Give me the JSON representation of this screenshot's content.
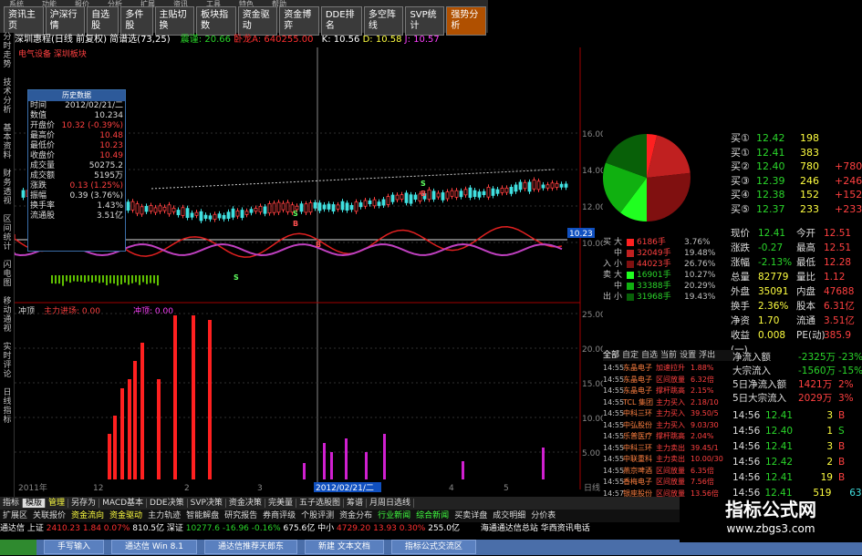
{
  "menu": [
    "系统",
    "功能",
    "报价",
    "分析",
    "扩展",
    "资讯",
    "工具",
    "特色",
    "帮助"
  ],
  "navtabs": [
    {
      "label": "资讯主页"
    },
    {
      "label": "沪深行情"
    },
    {
      "label": "自选股"
    },
    {
      "label": "多件股"
    },
    {
      "label": "主贴切换"
    },
    {
      "label": "板块指数"
    },
    {
      "label": "资金驱动"
    },
    {
      "label": "资金博弈"
    },
    {
      "label": "DDE排名"
    },
    {
      "label": "多空阵线"
    },
    {
      "label": "SVP统计"
    },
    {
      "label": "强势分析",
      "active": true
    }
  ],
  "left_tabs": [
    "分时走势",
    "技术分析",
    "基本资料",
    "财务透视",
    "区间统计",
    "闪电图",
    "移动通视",
    "实时评论",
    "日线指标"
  ],
  "title": {
    "name": "深圳惠程(日线 前复权)",
    "period": "简谱选(73,25)",
    "price_label": "震谨: 20.66",
    "amount_label": "卧龙A: 640255.00",
    "k": "K: 10.56",
    "d": "D: 10.58",
    "j": "J: 10.57"
  },
  "chart_annot": "电气设备 深圳板块",
  "y_ticks_upper": [
    "16.00",
    "14.00",
    "12.00",
    "10.00"
  ],
  "current_price_tag": "10.23",
  "y_ticks_lower": [
    "25.00",
    "20.00",
    "15.00",
    "10.00",
    "5.00"
  ],
  "lower_label": "冲顶",
  "lower_label2": "主力进场: 0.00",
  "lower_label3": "冲顶: 0.00",
  "x_axis": [
    "2011年",
    "12",
    "2",
    "3",
    "2012/02/21/二",
    "4",
    "5",
    "日线"
  ],
  "markers": [
    "S",
    "B",
    "S",
    "B",
    "S",
    "B"
  ],
  "info": {
    "header": "历史数据",
    "rows": [
      {
        "k": "时间",
        "v": "2012/02/21/二"
      },
      {
        "k": "数值",
        "v": "10.234"
      },
      {
        "k": "开盘价",
        "v": "10.32 (-0.39%)"
      },
      {
        "k": "最高价",
        "v": "10.48"
      },
      {
        "k": "最低价",
        "v": "10.23"
      },
      {
        "k": "收盘价",
        "v": "10.49"
      },
      {
        "k": "成交量",
        "v": "50275.2"
      },
      {
        "k": "成交额",
        "v": "5195万"
      },
      {
        "k": "涨跌",
        "v": "0.13 (1.25%)"
      },
      {
        "k": "振幅",
        "v": "0.39 (3.76%)"
      },
      {
        "k": "换手率",
        "v": "1.43%"
      },
      {
        "k": "流通股",
        "v": "3.51亿"
      }
    ]
  },
  "buy_levels": [
    {
      "label": "买①",
      "price": "12.42",
      "vol": "198",
      "chg": ""
    },
    {
      "label": "买①",
      "price": "12.41",
      "vol": "383",
      "chg": ""
    },
    {
      "label": "买②",
      "price": "12.40",
      "vol": "780",
      "chg": "+780"
    },
    {
      "label": "买③",
      "price": "12.39",
      "vol": "246",
      "chg": "+246"
    },
    {
      "label": "买④",
      "price": "12.38",
      "vol": "152",
      "chg": "+152"
    },
    {
      "label": "买⑤",
      "price": "12.37",
      "vol": "233",
      "chg": "+233"
    }
  ],
  "pie_legend": [
    {
      "side": "买",
      "size": "大",
      "vol": "6186手",
      "pct": "3.76%"
    },
    {
      "side": "",
      "size": "中",
      "vol": "32049手",
      "pct": "19.48%"
    },
    {
      "side": "入",
      "size": "小",
      "vol": "44023手",
      "pct": "26.76%"
    },
    {
      "side": "卖",
      "size": "大",
      "vol": "16901手",
      "pct": "10.27%"
    },
    {
      "side": "",
      "size": "中",
      "vol": "33388手",
      "pct": "20.29%"
    },
    {
      "side": "出",
      "size": "小",
      "vol": "31968手",
      "pct": "19.43%"
    }
  ],
  "pie_values": [
    3.76,
    19.48,
    26.76,
    10.27,
    20.29,
    19.43
  ],
  "quote": [
    {
      "k": "现价",
      "v": "12.41",
      "k2": "今开",
      "v2": "12.51"
    },
    {
      "k": "涨跌",
      "v": "-0.27",
      "k2": "最高",
      "v2": "12.51"
    },
    {
      "k": "涨幅",
      "v": "-2.13%",
      "k2": "最低",
      "v2": "12.28"
    },
    {
      "k": "总量",
      "v": "82779",
      "k2": "量比",
      "v2": "1.12"
    },
    {
      "k": "外盘",
      "v": "35091",
      "k2": "内盘",
      "v2": "47688"
    },
    {
      "k": "换手",
      "v": "2.36%",
      "k2": "股本",
      "v2": "6.31亿"
    },
    {
      "k": "净资",
      "v": "1.70",
      "k2": "流通",
      "v2": "3.51亿"
    },
    {
      "k": "收益(一)",
      "v": "0.008",
      "k2": "PE(动)",
      "v2": "385.9"
    }
  ],
  "flow_tabs": [
    "全部",
    "自定",
    "自选",
    "当前",
    "设置",
    "浮出"
  ],
  "flows": [
    {
      "t": "14:55",
      "name": "东晶电子",
      "act": "加速拉升",
      "pct": "1.88%"
    },
    {
      "t": "14:55",
      "name": "东晶电子",
      "act": "区间放量",
      "pct": "6.32倍"
    },
    {
      "t": "14:55",
      "name": "东晶电子",
      "act": "撑杆跳高",
      "pct": "2.15%"
    },
    {
      "t": "14:55",
      "name": "TCL 集团",
      "act": "主力买入",
      "pct": "2.18/10"
    },
    {
      "t": "14:55",
      "name": "中科三环",
      "act": "主力买入",
      "pct": "39.50/5"
    },
    {
      "t": "14:55",
      "name": "中弘股份",
      "act": "主力买入",
      "pct": "9.03/30"
    },
    {
      "t": "14:55",
      "name": "乐普医疗",
      "act": "撑杆跳高",
      "pct": "2.04%"
    },
    {
      "t": "14:55",
      "name": "中科三环",
      "act": "主力卖出",
      "pct": "39.45/1"
    },
    {
      "t": "14:55",
      "name": "中联重科",
      "act": "主力卖出",
      "pct": "10.00/30"
    },
    {
      "t": "14:55",
      "name": "燕京啤酒",
      "act": "区间放量",
      "pct": "6.35倍"
    },
    {
      "t": "14:55",
      "name": "香梅电子",
      "act": "区间放量",
      "pct": "7.56倍"
    },
    {
      "t": "14:57",
      "name": "银座股份",
      "act": "区间放量",
      "pct": "13.56倍"
    }
  ],
  "netflow": [
    {
      "k": "净流入额",
      "v": "-2325万",
      "p": "-23%"
    },
    {
      "k": "大宗流入",
      "v": "-1560万",
      "p": "-15%"
    },
    {
      "k": "5日净流入额",
      "v": "1421万",
      "p": "2%"
    },
    {
      "k": "5日大宗流入",
      "v": "2029万",
      "p": "3%"
    }
  ],
  "ticks": [
    {
      "t": "14:56",
      "p": "12.41",
      "v": "3",
      "s": "B"
    },
    {
      "t": "14:56",
      "p": "12.40",
      "v": "1",
      "s": "S"
    },
    {
      "t": "14:56",
      "p": "12.41",
      "v": "3",
      "s": "B"
    },
    {
      "t": "14:56",
      "p": "12.42",
      "v": "2",
      "s": "B"
    },
    {
      "t": "14:56",
      "p": "12.41",
      "v": "19",
      "s": "B"
    },
    {
      "t": "14:56",
      "p": "12.41",
      "v": "519",
      "s": "",
      "x": "63"
    }
  ],
  "bottom_tabs": [
    "指标",
    "模版",
    "管理",
    "另存为",
    "MACD基本",
    "DDE决策",
    "SVP决策",
    "资金决策",
    "完美量",
    "五子选股图",
    "筹谱",
    "月周日选线"
  ],
  "bottom_tabs2": [
    "扩展区",
    "关联报价",
    "资金流向",
    "资金驱动",
    "主力轨迹",
    "智能解盘",
    "研究报告",
    "券商评级",
    "个股评测",
    "资金分布",
    "行业新闻",
    "综合新闻",
    "买卖详盘",
    "成交明细",
    "分价表"
  ],
  "right_bottom_tabs": [
    "资讯工场",
    "主力",
    "风向",
    "资"
  ],
  "indices": {
    "sh_label": "通达信",
    "sh": "上证",
    "sh_val": "2410.23",
    "sh_chg": "1.84",
    "sh_pct": "0.07%",
    "sh_amt": "810.5亿",
    "sz": "深证",
    "sz_val": "10277.6",
    "sz_chg": "-16.96",
    "sz_pct": "-0.16%",
    "sz_amt": "675.6亿",
    "zx": "中小",
    "zx_val": "4729.20",
    "zx_chg": "13.93",
    "zx_pct": "0.30%",
    "zx_amt": "255.0亿",
    "broker": "海通通达信总站",
    "broker2": "华西资讯电话"
  },
  "taskbar": [
    "手写输入",
    "通达信 Win 8.1",
    "通达信推荐天郎东",
    "新建 文本文档",
    "指标公式交流区"
  ],
  "watermark": {
    "title": "指标公式网",
    "url": "www.zbgs3.com"
  }
}
